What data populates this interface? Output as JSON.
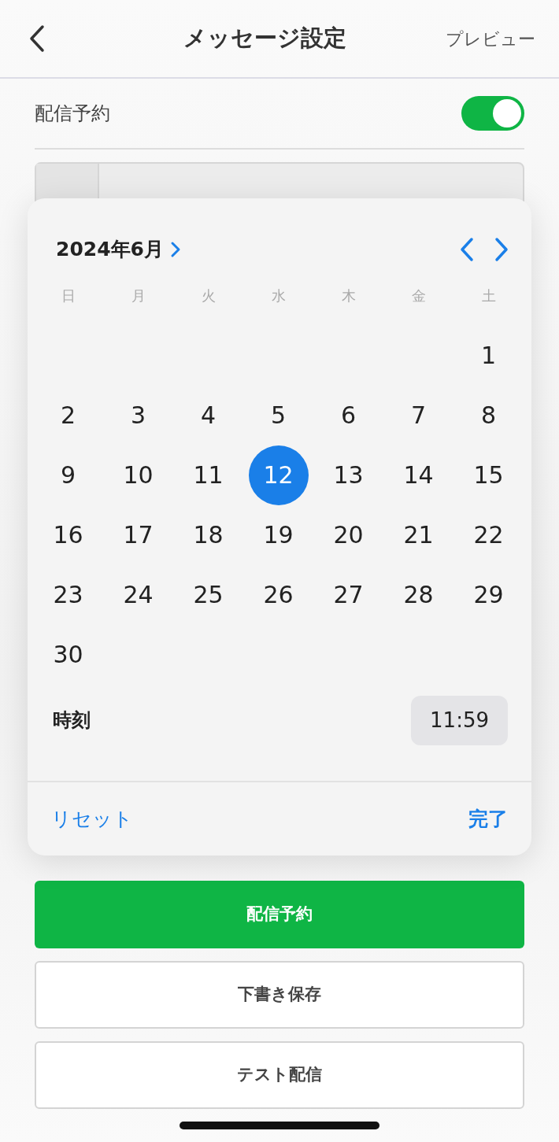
{
  "header": {
    "title": "メッセージ設定",
    "action": "プレビュー"
  },
  "schedule": {
    "label": "配信予約",
    "on": true
  },
  "picker": {
    "month": "2024年6月",
    "weekdays": [
      "日",
      "月",
      "火",
      "水",
      "木",
      "金",
      "土"
    ],
    "weeks": [
      [
        {
          "day": "1",
          "selected": false
        }
      ],
      [
        {
          "day": "2",
          "selected": false
        },
        {
          "day": "3",
          "selected": false
        },
        {
          "day": "4",
          "selected": false
        },
        {
          "day": "5",
          "selected": false
        },
        {
          "day": "6",
          "selected": false
        },
        {
          "day": "7",
          "selected": false
        },
        {
          "day": "8",
          "selected": false
        }
      ],
      [
        {
          "day": "9",
          "selected": false
        },
        {
          "day": "10",
          "selected": false
        },
        {
          "day": "11",
          "selected": false
        },
        {
          "day": "12",
          "selected": true
        },
        {
          "day": "13",
          "selected": false
        },
        {
          "day": "14",
          "selected": false
        },
        {
          "day": "15",
          "selected": false
        }
      ],
      [
        {
          "day": "16",
          "selected": false
        },
        {
          "day": "17",
          "selected": false
        },
        {
          "day": "18",
          "selected": false
        },
        {
          "day": "19",
          "selected": false
        },
        {
          "day": "20",
          "selected": false
        },
        {
          "day": "21",
          "selected": false
        },
        {
          "day": "22",
          "selected": false
        }
      ],
      [
        {
          "day": "23",
          "selected": false
        },
        {
          "day": "24",
          "selected": false
        },
        {
          "day": "25",
          "selected": false
        },
        {
          "day": "26",
          "selected": false
        },
        {
          "day": "27",
          "selected": false
        },
        {
          "day": "28",
          "selected": false
        },
        {
          "day": "29",
          "selected": false
        }
      ],
      [
        {
          "day": "30",
          "selected": false
        }
      ]
    ],
    "time_label": "時刻",
    "time": "11:59",
    "reset": "リセット",
    "done": "完了"
  },
  "buttons": [
    {
      "label": "配信予約",
      "kind": "primary"
    },
    {
      "label": "下書き保存",
      "kind": "outline"
    },
    {
      "label": "テスト配信",
      "kind": "outline"
    }
  ]
}
